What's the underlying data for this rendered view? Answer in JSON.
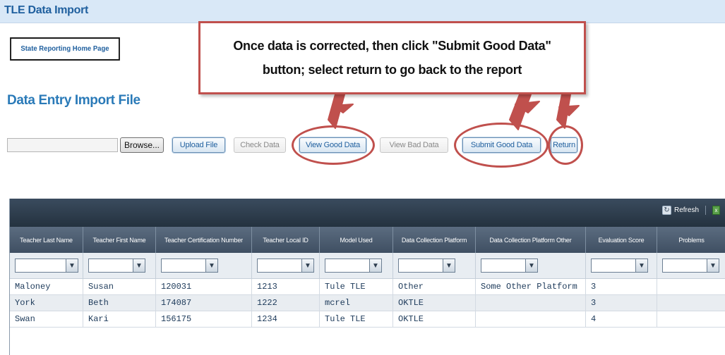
{
  "app": {
    "title": "TLE Data Import"
  },
  "nav": {
    "home_link": "State Reporting Home Page"
  },
  "page": {
    "title": "Data Entry Import File"
  },
  "callout": {
    "line1": "Once data is corrected, then click \"Submit Good Data\"",
    "line2": "button; select return to go back to the report"
  },
  "file_row": {
    "file_value": "",
    "browse": "Browse...",
    "upload": "Upload File",
    "check": "Check Data",
    "view_good": "View Good Data",
    "view_bad": "View Bad Data",
    "submit_good": "Submit Good Data",
    "return": "Return"
  },
  "grid": {
    "toolbar": {
      "refresh": "Refresh"
    },
    "columns": [
      "Teacher Last Name",
      "Teacher First Name",
      "Teacher Certification Number",
      "Teacher Local ID",
      "Model Used",
      "Data Collection Platform",
      "Data Collection Platform Other",
      "Evaluation Score",
      "Problems"
    ],
    "rows": [
      [
        "Maloney",
        "Susan",
        "120031",
        "1213",
        "Tule TLE",
        "Other",
        "Some Other Platform",
        "3",
        ""
      ],
      [
        "York",
        "Beth",
        "174087",
        "1222",
        "mcrel",
        "OKTLE",
        "",
        "3",
        ""
      ],
      [
        "Swan",
        "Kari",
        "156175",
        "1234",
        "Tule TLE",
        "OKTLE",
        "",
        "4",
        ""
      ]
    ]
  },
  "colors": {
    "annotation": "#c0504d",
    "title_blue": "#2a7ab8",
    "header_bar": "#d9e8f7",
    "grid_header": "#3f4f62"
  },
  "icons": {
    "refresh": "refresh-icon",
    "export": "excel-export-icon",
    "filter": "filter-icon"
  }
}
